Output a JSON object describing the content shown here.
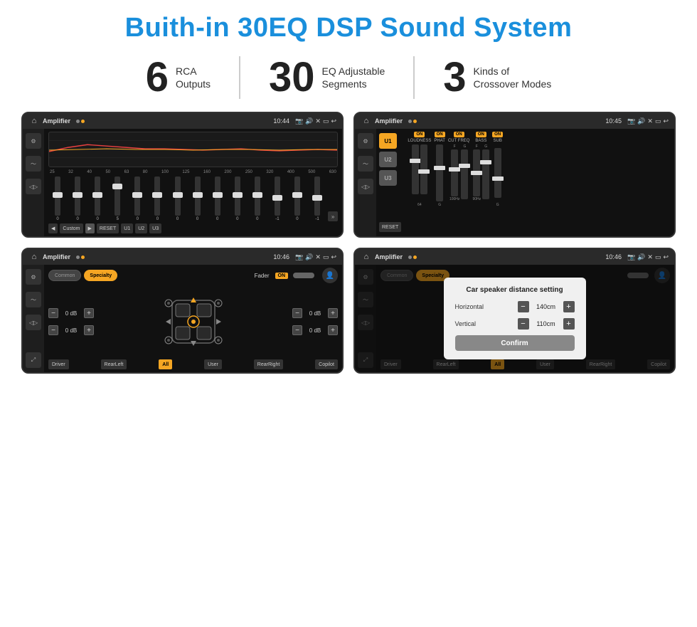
{
  "title": "Buith-in 30EQ DSP Sound System",
  "stats": [
    {
      "number": "6",
      "text": "RCA\nOutputs"
    },
    {
      "number": "30",
      "text": "EQ Adjustable\nSegments"
    },
    {
      "number": "3",
      "text": "Kinds of\nCrossover Modes"
    }
  ],
  "screen1": {
    "title": "Amplifier",
    "time": "10:44",
    "eq_freqs": [
      "25",
      "32",
      "40",
      "50",
      "63",
      "80",
      "100",
      "125",
      "160",
      "200",
      "250",
      "320",
      "400",
      "500",
      "630"
    ],
    "eq_values": [
      "0",
      "0",
      "0",
      "5",
      "0",
      "0",
      "0",
      "0",
      "0",
      "0",
      "0",
      "-1",
      "0",
      "-1"
    ],
    "buttons": [
      "Custom",
      "RESET",
      "U1",
      "U2",
      "U3"
    ]
  },
  "screen2": {
    "title": "Amplifier",
    "time": "10:45",
    "u_buttons": [
      "U1",
      "U2",
      "U3"
    ],
    "sliders": [
      "LOUDNESS",
      "PHAT",
      "CUT FREQ",
      "BASS",
      "SUB"
    ],
    "reset_label": "RESET"
  },
  "screen3": {
    "title": "Amplifier",
    "time": "10:46",
    "modes": [
      "Common",
      "Specialty"
    ],
    "fader_label": "Fader",
    "fader_on": "ON",
    "vol_controls": [
      {
        "label": "",
        "value": "0 dB"
      },
      {
        "label": "",
        "value": "0 dB"
      },
      {
        "label": "",
        "value": "0 dB"
      },
      {
        "label": "",
        "value": "0 dB"
      }
    ],
    "nav_buttons": [
      "Driver",
      "RearLeft",
      "All",
      "User",
      "RearRight",
      "Copilot"
    ]
  },
  "screen4": {
    "title": "Amplifier",
    "time": "10:46",
    "modes": [
      "Common",
      "Specialty"
    ],
    "dialog": {
      "title": "Car speaker distance setting",
      "horizontal_label": "Horizontal",
      "horizontal_value": "140cm",
      "vertical_label": "Vertical",
      "vertical_value": "110cm",
      "confirm_label": "Confirm"
    },
    "nav_buttons": [
      "Driver",
      "RearLeft",
      "All",
      "User",
      "RearRight",
      "Copilot"
    ]
  }
}
